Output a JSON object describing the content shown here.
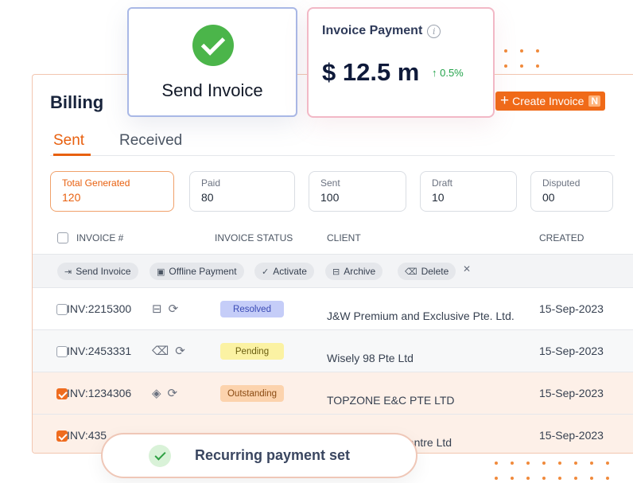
{
  "billing": {
    "title": "Billing",
    "create_button": "Create Invoice",
    "create_shortcut": "N"
  },
  "tabs": [
    {
      "label": "Sent",
      "active": true
    },
    {
      "label": "Received",
      "active": false
    }
  ],
  "stats": [
    {
      "label": "Total Generated",
      "value": "120",
      "active": true
    },
    {
      "label": "Paid",
      "value": "80"
    },
    {
      "label": "Sent",
      "value": "100"
    },
    {
      "label": "Draft",
      "value": "10"
    },
    {
      "label": "Disputed",
      "value": "00"
    }
  ],
  "table": {
    "columns": [
      "INVOICE #",
      "INVOICE STATUS",
      "CLIENT",
      "CREATED"
    ],
    "bulk_actions": [
      "Send Invoice",
      "Offline Payment",
      "Activate",
      "Archive",
      "Delete"
    ],
    "rows": [
      {
        "invoice": "INV:2215300",
        "status": "Resolved",
        "client": "J&W Premium and Exclusive Pte. Ltd.",
        "created": "15-Sep-2023",
        "checked": false
      },
      {
        "invoice": "INV:2453331",
        "status": "Pending",
        "client": "Wisely 98 Pte Ltd",
        "created": "15-Sep-2023",
        "checked": false
      },
      {
        "invoice": "INV:1234306",
        "status": "Outstanding",
        "client": "TOPZONE E&C PTE LTD",
        "created": "15-Sep-2023",
        "checked": true
      },
      {
        "invoice": "INV:435",
        "status": "",
        "client": "g Centre Ltd",
        "created": "15-Sep-2023",
        "checked": true
      }
    ]
  },
  "send_invoice_card": {
    "title": "Send Invoice"
  },
  "payment_card": {
    "title": "Invoice Payment",
    "info_glyph": "i",
    "amount": "$ 12.5 m",
    "delta": "↑ 0.5%"
  },
  "toast": {
    "message": "Recurring payment set"
  },
  "colors": {
    "accent": "#e8600f",
    "success": "#4bb54a",
    "resolved_bg": "#c5cdf8",
    "pending_bg": "#fbf2a3",
    "outstanding_bg": "#fcd3ad"
  }
}
